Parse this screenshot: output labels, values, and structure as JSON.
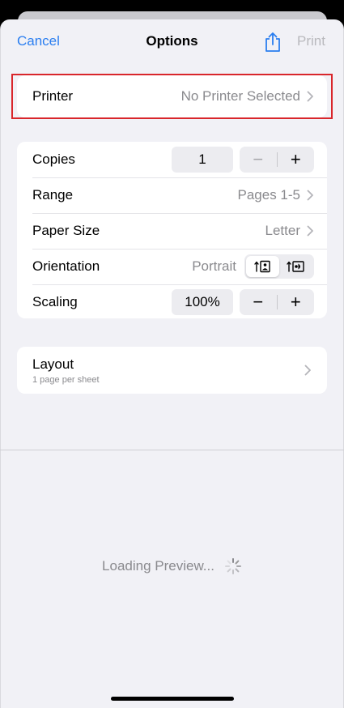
{
  "nav": {
    "cancel": "Cancel",
    "title": "Options",
    "print": "Print"
  },
  "printer": {
    "label": "Printer",
    "value": "No Printer Selected"
  },
  "options": {
    "copies": {
      "label": "Copies",
      "value": "1",
      "minus": "−",
      "plus": "+"
    },
    "range": {
      "label": "Range",
      "value": "Pages 1-5"
    },
    "paper_size": {
      "label": "Paper Size",
      "value": "Letter"
    },
    "orientation": {
      "label": "Orientation",
      "value": "Portrait",
      "selected": "portrait"
    },
    "scaling": {
      "label": "Scaling",
      "value": "100%",
      "minus": "−",
      "plus": "+"
    }
  },
  "layout": {
    "title": "Layout",
    "subtitle": "1 page per sheet"
  },
  "preview": {
    "loading_text": "Loading Preview..."
  },
  "colors": {
    "accent": "#2a7ef0",
    "highlight": "#d9262b"
  }
}
